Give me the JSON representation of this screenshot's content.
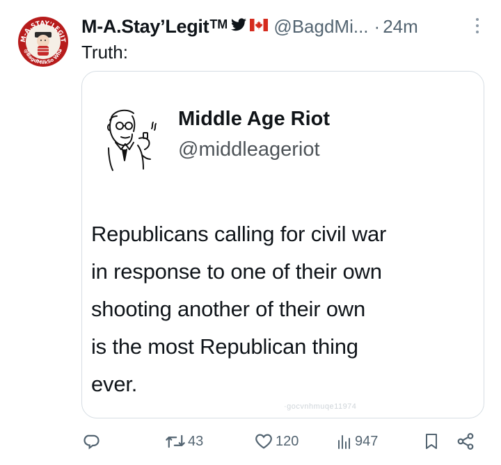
{
  "post": {
    "display_name": "M-A.Stay’Legit",
    "tm_mark": "TM",
    "handle": "@BagdMi...",
    "separator": "·",
    "timestamp": "24m",
    "text": "Truth:",
    "avatar_text": {
      "top": "M-A.STAY'LEGIT",
      "bottom": "@BagdMilkSo Wha"
    }
  },
  "quote": {
    "name": "Middle Age Riot",
    "handle": "@middleageriot",
    "lines": [
      "Republicans calling for civil war",
      "in response to one of their own",
      "shooting another of their own",
      "is the most Republican thing",
      "ever."
    ],
    "watermark": "·gocvnhmuqe11974"
  },
  "actions": {
    "reply_count": "",
    "retweet_count": "43",
    "like_count": "120",
    "view_count": "947"
  },
  "colors": {
    "text_primary": "#0f1419",
    "text_secondary": "#536471",
    "border": "#d6dde3",
    "avatar_red": "#c62828",
    "flag_red": "#d52b1e"
  },
  "icons": [
    "more-icon",
    "bird-icon",
    "flag-icon",
    "reply-icon",
    "retweet-icon",
    "like-icon",
    "views-icon",
    "bookmark-icon",
    "share-icon"
  ]
}
